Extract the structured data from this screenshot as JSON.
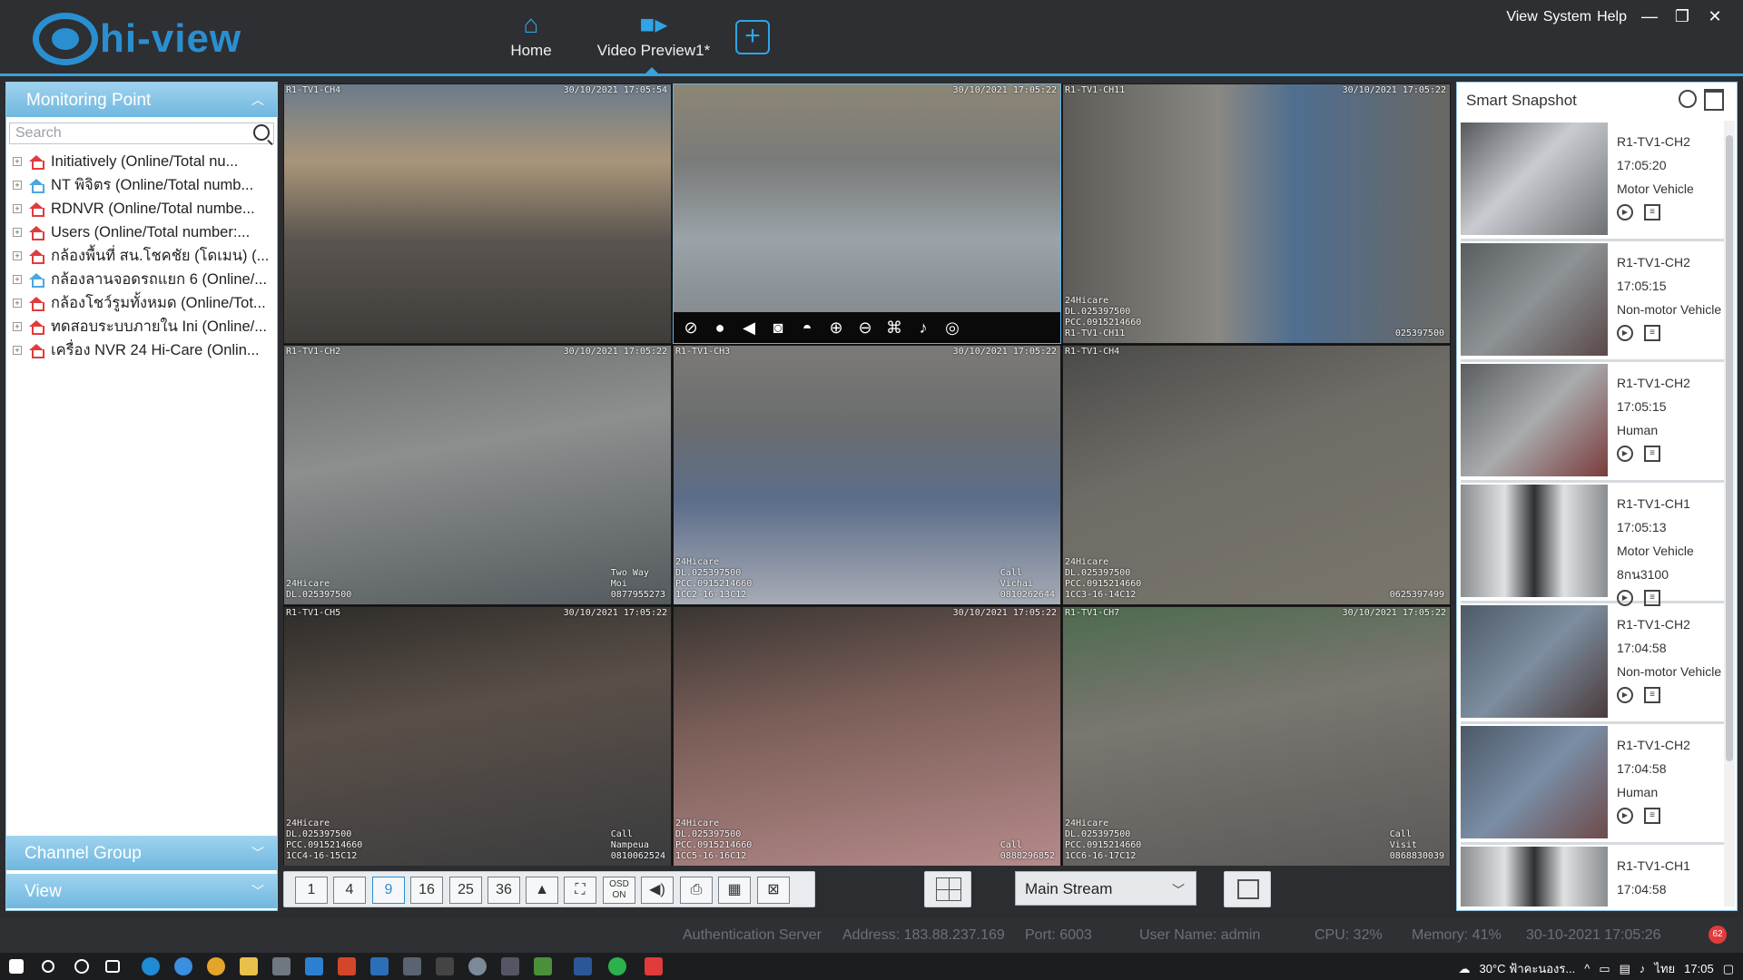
{
  "app": {
    "logo_text": "hi-view"
  },
  "nav": {
    "home_label": "Home",
    "video_label": "Video Preview1*"
  },
  "top_menu": {
    "view": "View",
    "system": "System",
    "help": "Help"
  },
  "left_panel": {
    "title": "Monitoring Point",
    "search_placeholder": "Search",
    "items": [
      {
        "label": "Initiatively (Online/Total nu...",
        "color": "#e03c3c"
      },
      {
        "label": "NT พิจิตร (Online/Total numb...",
        "color": "#4aa8e0"
      },
      {
        "label": "RDNVR (Online/Total numbe...",
        "color": "#e03c3c"
      },
      {
        "label": "Users (Online/Total number:...",
        "color": "#e03c3c"
      },
      {
        "label": "กล้องพื้นที่ สน.โชคชัย (โดเมน) (...",
        "color": "#e03c3c"
      },
      {
        "label": "กล้องลานจอดรถแยก 6 (Online/...",
        "color": "#4aa8e0"
      },
      {
        "label": "กล้องโชว์รูมทั้งหมด (Online/Tot...",
        "color": "#e03c3c"
      },
      {
        "label": "ทดสอบระบบภายใน Ini (Online/...",
        "color": "#e03c3c"
      },
      {
        "label": "เครื่อง NVR 24 Hi-Care (Onlin...",
        "color": "#e03c3c"
      }
    ],
    "channel_group": "Channel Group",
    "view": "View"
  },
  "cameras": [
    {
      "tl": "R1-TV1-CH4",
      "tr": "30/10/2021 17:05:54",
      "bl": "",
      "br": ""
    },
    {
      "tl": "",
      "tr": "30/10/2021 17:05:22",
      "bl": "",
      "br": ""
    },
    {
      "tl": "R1-TV1-CH11",
      "tr": "30/10/2021 17:05:22",
      "bl": "24Hicare\nDL.025397500\nPCC.0915214660\nR1-TV1-CH11",
      "br": "025397500"
    },
    {
      "tl": "R1-TV1-CH2",
      "tr": "30/10/2021 17:05:22",
      "bl": "24Hicare\nDL.025397500",
      "br": "Two Way\nMoi\n0877955273"
    },
    {
      "tl": "R1-TV1-CH3",
      "tr": "30/10/2021 17:05:22",
      "bl": "24Hicare\nDL.025397500\nPCC.0915214660\n1CC2-16-13C12",
      "br": "Call\nVichai\n0810262644"
    },
    {
      "tl": "R1-TV1-CH4",
      "tr": "",
      "bl": "24Hicare\nDL.025397500\nPCC.0915214660\n1CC3-16-14C12",
      "br": "0625397499"
    },
    {
      "tl": "R1-TV1-CH5",
      "tr": "30/10/2021 17:05:22",
      "bl": "24Hicare\nDL.025397500\nPCC.0915214660\n1CC4-16-15C12",
      "br": "Call\nNampeua\n0810062524"
    },
    {
      "tl": "",
      "tr": "30/10/2021 17:05:22",
      "bl": "24Hicare\nDL.025397500\nPCC.0915214660\n1CC5-16-16C12",
      "br": "Call\n0888296852"
    },
    {
      "tl": "R1-TV1-CH7",
      "tr": "30/10/2021 17:05:22",
      "bl": "24Hicare\nDL.025397500\nPCC.0915214660\n1CC6-16-17C12",
      "br": "Call\nVisit\n0868830039"
    }
  ],
  "layouts": [
    "1",
    "4",
    "9",
    "16",
    "25",
    "36"
  ],
  "toolbar": {
    "osd": "OSD\nON",
    "stream_value": "Main Stream"
  },
  "snapshot": {
    "title": "Smart Snapshot",
    "items": [
      {
        "channel": "R1-TV1-CH2",
        "time": "17:05:20",
        "type": "Motor Vehicle",
        "extra": ""
      },
      {
        "channel": "R1-TV1-CH2",
        "time": "17:05:15",
        "type": "Non-motor Vehicle",
        "extra": ""
      },
      {
        "channel": "R1-TV1-CH2",
        "time": "17:05:15",
        "type": "Human",
        "extra": ""
      },
      {
        "channel": "R1-TV1-CH1",
        "time": "17:05:13",
        "type": "Motor Vehicle",
        "extra": "8กน3100"
      },
      {
        "channel": "R1-TV1-CH2",
        "time": "17:04:58",
        "type": "Non-motor Vehicle",
        "extra": ""
      },
      {
        "channel": "R1-TV1-CH2",
        "time": "17:04:58",
        "type": "Human",
        "extra": ""
      },
      {
        "channel": "R1-TV1-CH1",
        "time": "17:04:58",
        "type": "Motor Vehicle",
        "extra": ""
      }
    ]
  },
  "status": {
    "auth": "Authentication Server",
    "address": "Address: 183.88.237.169",
    "port": "Port: 6003",
    "user": "User Name: admin",
    "cpu": "CPU: 32%",
    "memory": "Memory: 41%",
    "datetime": "30-10-2021 17:05:26",
    "alarm_count": "62"
  },
  "taskbar": {
    "weather": "30°C ฟ้าคะนองร...",
    "lang": "ไทย",
    "clock": "17:05"
  }
}
